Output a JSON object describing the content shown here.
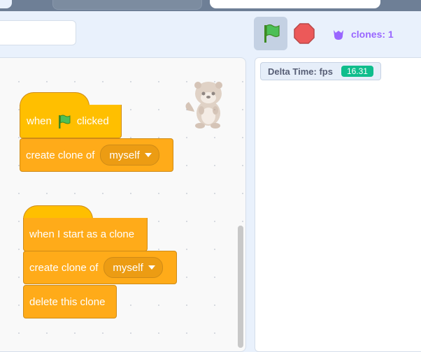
{
  "toolbar": {
    "project_title_value": "",
    "green_flag_icon": "green-flag-icon",
    "stop_icon": "stop-sign-icon",
    "clones_label": "clones: 1"
  },
  "stage": {
    "monitor": {
      "label": "Delta Time: fps",
      "value": "16.31"
    }
  },
  "scripts": {
    "script1": {
      "hat_when": "when",
      "hat_clicked": "clicked",
      "create_clone_label": "create clone of",
      "create_clone_target": "myself"
    },
    "script2": {
      "hat_label": "when I start as a clone",
      "create_clone_label": "create clone of",
      "create_clone_target": "myself",
      "delete_label": "delete this clone"
    }
  },
  "colors": {
    "control": "#ffab19",
    "events": "#ffbf00",
    "monitor_value": "#0fbd8c",
    "clones_text": "#9966ff"
  }
}
